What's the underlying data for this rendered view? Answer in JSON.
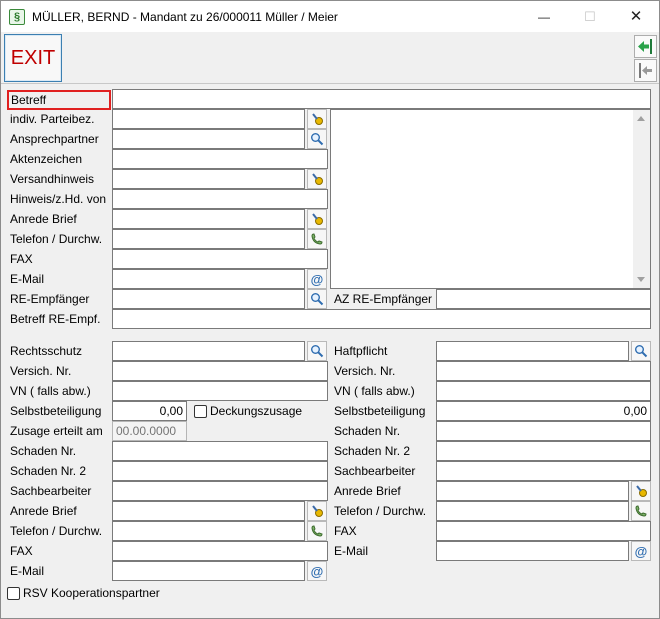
{
  "window": {
    "title": "MÜLLER, BERND - Mandant zu 26/000011 Müller / Meier",
    "app_icon_glyph": "§",
    "minimize": "—",
    "maximize": "☐",
    "close": "✕"
  },
  "toolbar": {
    "exit_label": "EXIT",
    "accent": "#c00000"
  },
  "form": {
    "betreff": "Betreff",
    "indiv_parteibez": "indiv. Parteibez.",
    "ansprechpartner": "Ansprechpartner",
    "aktenzeichen": "Aktenzeichen",
    "versandhinweis": "Versandhinweis",
    "hinweis_zhd": "Hinweis/z.Hd. von",
    "anrede_brief": "Anrede Brief",
    "telefon": "Telefon / Durchw.",
    "fax": "FAX",
    "email": "E-Mail",
    "re_empfaenger": "RE-Empfänger",
    "az_re_empfaenger": "AZ RE-Empfänger",
    "betreff_re_empf": "Betreff RE-Empf."
  },
  "rechtsschutz": {
    "label": "Rechtsschutz",
    "versich_nr": "Versich. Nr.",
    "vn": "VN ( falls abw.)",
    "selbstbeteiligung": "Selbstbeteiligung",
    "selbstbeteiligung_value": "0,00",
    "deckungszusage": "Deckungszusage",
    "zusage_erteilt": "Zusage erteilt am",
    "zusage_date_placeholder": "00.00.0000",
    "schaden_nr": "Schaden Nr.",
    "schaden_nr2": "Schaden Nr. 2",
    "sachbearbeiter": "Sachbearbeiter",
    "anrede_brief": "Anrede Brief",
    "telefon": "Telefon / Durchw.",
    "fax": "FAX",
    "email": "E-Mail",
    "rsv_koop": "RSV Kooperationspartner"
  },
  "haftpflicht": {
    "label": "Haftpflicht",
    "versich_nr": "Versich. Nr.",
    "vn": "VN ( falls abw.)",
    "selbstbeteiligung": "Selbstbeteiligung",
    "selbstbeteiligung_value": "0,00",
    "schaden_nr": "Schaden Nr.",
    "schaden_nr2": "Schaden Nr. 2",
    "sachbearbeiter": "Sachbearbeiter",
    "anrede_brief": "Anrede Brief",
    "telefon": "Telefon / Durchw.",
    "fax": "FAX",
    "email": "E-Mail"
  },
  "icons": {
    "at_glyph": "@"
  }
}
